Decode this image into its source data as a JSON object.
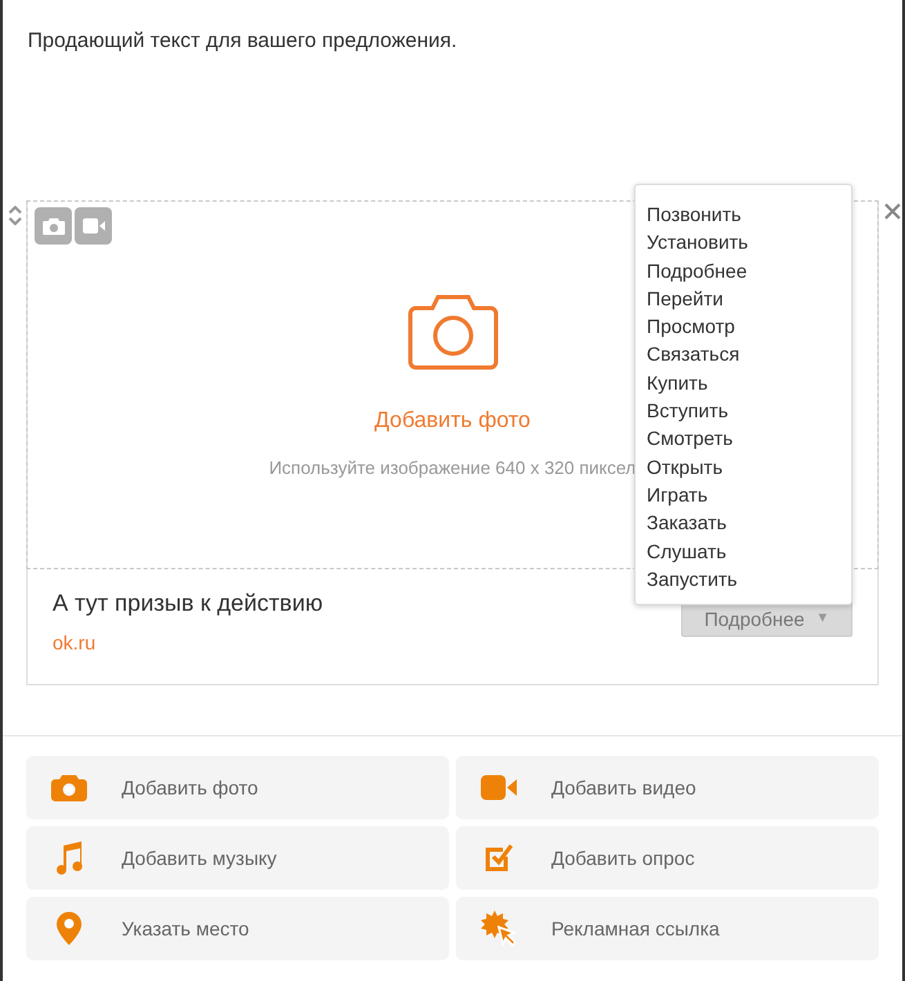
{
  "description": "Продающий текст для вашего предложения.",
  "media": {
    "add_label": "Добавить фото",
    "hint": "Используйте изображение 640 x 320 пиксел"
  },
  "cta": {
    "title": "А тут призыв к действию",
    "link": "ok.ru",
    "button": "Подробнее",
    "caret": "▼"
  },
  "dropdown": [
    "Позвонить",
    "Установить",
    "Подробнее",
    "Перейти",
    "Просмотр",
    "Связаться",
    "Купить",
    "Вступить",
    "Смотреть",
    "Открыть",
    "Играть",
    "Заказать",
    "Слушать",
    "Запустить"
  ],
  "actions": [
    {
      "kind": "photo",
      "label": "Добавить фото"
    },
    {
      "kind": "video",
      "label": "Добавить видео"
    },
    {
      "kind": "music",
      "label": "Добавить музыку"
    },
    {
      "kind": "poll",
      "label": "Добавить опрос"
    },
    {
      "kind": "place",
      "label": "Указать место"
    },
    {
      "kind": "ad",
      "label": "Рекламная ссылка"
    }
  ]
}
